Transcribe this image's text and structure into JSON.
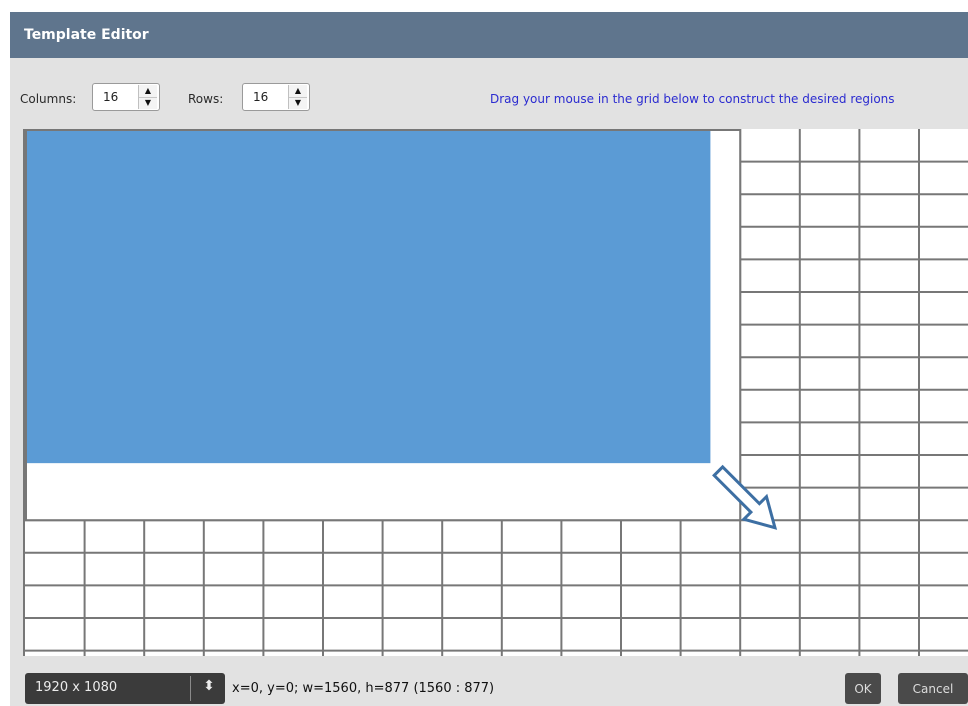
{
  "window": {
    "title": "Template Editor"
  },
  "toolbar": {
    "columns_label": "Columns:",
    "columns_value": "16",
    "rows_label": "Rows:",
    "rows_value": "16",
    "hint": "Drag your mouse in the grid below to construct the desired regions"
  },
  "grid": {
    "columns": 16,
    "rows": 16,
    "selection": {
      "col_start": 0,
      "row_start": 0,
      "cols": 11.5,
      "rows": 10.25
    },
    "selection_color": "#5b9bd5",
    "drag_arrow_color": "#3d6fa3"
  },
  "footer": {
    "resolution": "1920 x 1080",
    "coordinates": "x=0, y=0; w=1560, h=877 (1560 : 877)",
    "ok_label": "OK",
    "cancel_label": "Cancel"
  },
  "colors": {
    "titlebar": "#5f758d",
    "panel": "#e2e2e2",
    "hint_text": "#2b2bd0"
  }
}
